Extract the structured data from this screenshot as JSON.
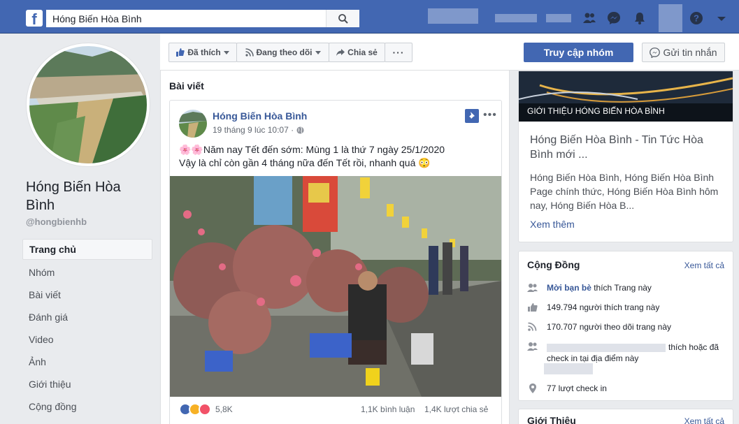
{
  "topbar": {
    "search_value": "Hóng Biến Hòa Bình",
    "logo": "f",
    "icons": [
      "search-icon",
      "friends-icon",
      "messenger-icon",
      "notifications-icon",
      "help-icon",
      "dropdown-icon"
    ]
  },
  "colors": {
    "brand": "#4267b2",
    "link": "#385898",
    "bg": "#e9ebee"
  },
  "sidebar": {
    "page_name": "Hóng Biến Hòa Bình",
    "handle": "@hongbienhb",
    "nav": [
      {
        "label": "Trang chủ"
      },
      {
        "label": "Nhóm"
      },
      {
        "label": "Bài viết"
      },
      {
        "label": "Đánh giá"
      },
      {
        "label": "Video"
      },
      {
        "label": "Ảnh"
      },
      {
        "label": "Giới thiệu"
      },
      {
        "label": "Cộng đồng"
      }
    ]
  },
  "actions": {
    "liked": "Đã thích",
    "following": "Đang theo dõi",
    "share": "Chia sẻ",
    "more": "···",
    "visit_group": "Truy cập nhóm",
    "send_message": "Gửi tin nhắn"
  },
  "posts": {
    "heading": "Bài viết",
    "post": {
      "author": "Hóng Biến Hòa Bình",
      "time": "19 tháng 9 lúc 10:07 · ",
      "line1": "🌸🌸Năm nay Tết đến sớm: Mùng 1 là thứ 7 ngày 25/1/2020",
      "line2": "Vậy là chỉ còn gần 4 tháng nữa đến Tết rồi, nhanh quá 😳",
      "reaction_count": "5,8K",
      "comments": "1,1K bình luận",
      "shares": "1,4K lượt chia sẻ"
    }
  },
  "intro_card": {
    "banner_text": "GIỚI THIỆU HÓNG BIẾN HÒA BÌNH",
    "title": "Hóng Biến Hòa Bình - Tin Tức Hòa Bình mới ...",
    "description": "Hóng Biến Hòa Bình, Hóng Biến Hòa Bình Page chính thức, Hóng Biến Hòa Bình hôm nay, Hóng Biến Hòa B...",
    "see_more": "Xem thêm"
  },
  "community": {
    "title": "Cộng Đồng",
    "see_all": "Xem tất cả",
    "invite_link": "Mời bạn bè",
    "invite_rest": " thích Trang này",
    "likes": "149.794 người thích trang này",
    "followers": "170.707 người theo dõi trang này",
    "friends_like": "thích hoặc đã",
    "friends_checkin": "check in tại địa điểm này",
    "checkins": "77 lượt check in"
  },
  "about": {
    "title": "Giới Thiệu",
    "see_all": "Xem tất cả"
  }
}
